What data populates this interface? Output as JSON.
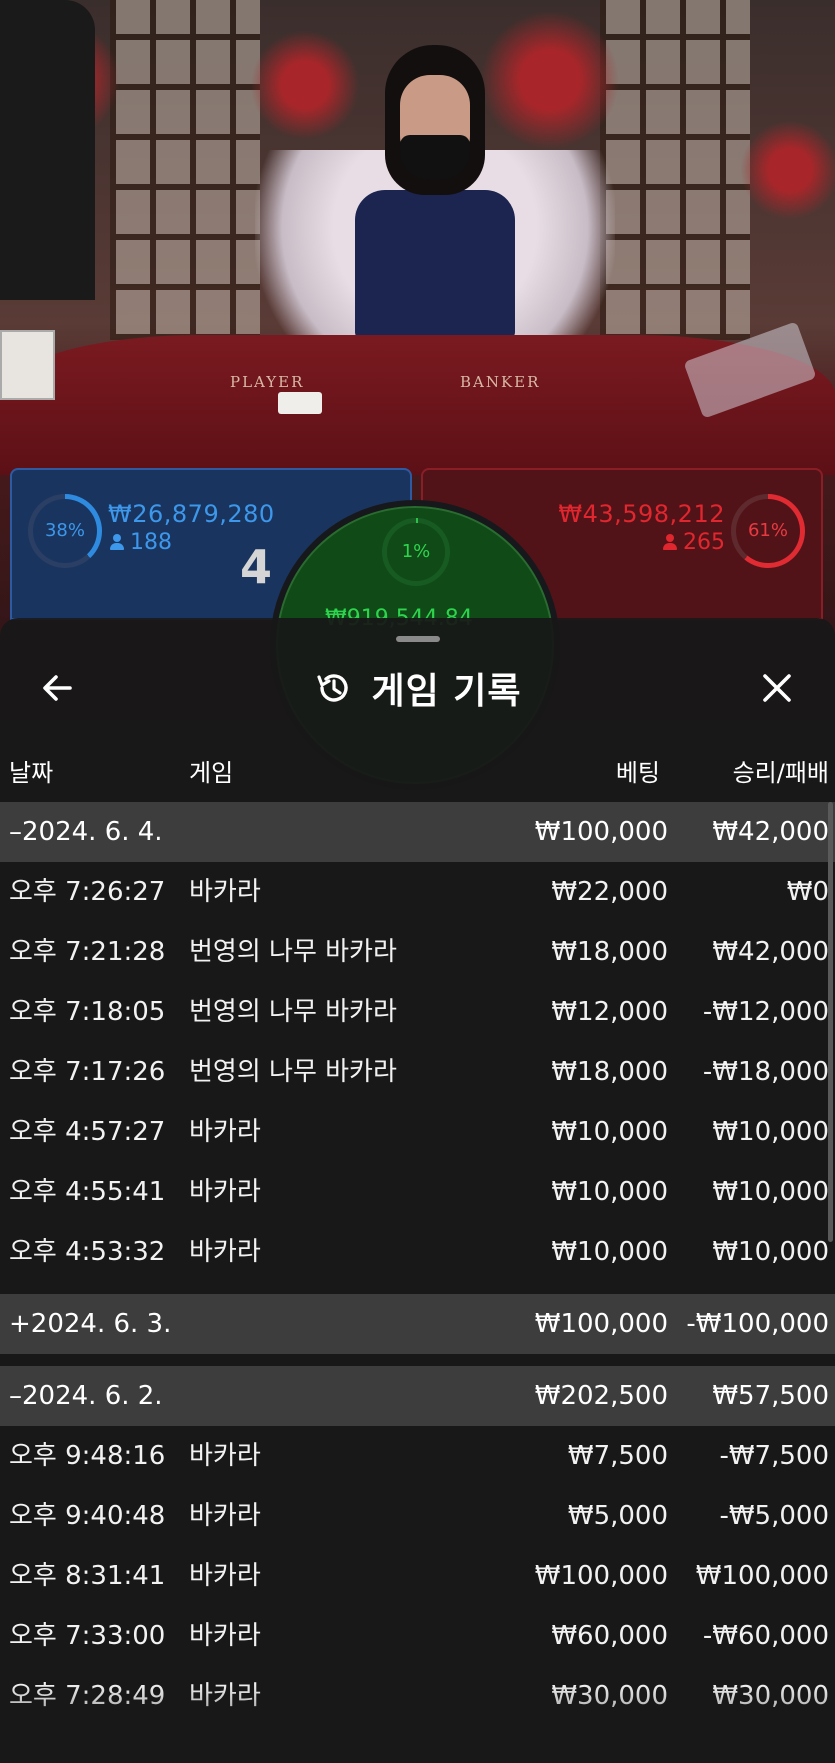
{
  "stream": {
    "table_labels": [
      "PLAYER",
      "BANKER"
    ]
  },
  "bets": {
    "player": {
      "percent": "38%",
      "amount": "₩26,879,280",
      "players": "188",
      "score": "4"
    },
    "banker": {
      "percent": "61%",
      "amount": "₩43,598,212",
      "players": "265"
    },
    "tie": {
      "percent": "1%",
      "amount": "₩919,544.84"
    }
  },
  "sheet": {
    "title": "게임 기록",
    "icons": {
      "back": "arrow-left-icon",
      "history": "history-icon",
      "close": "close-icon"
    },
    "columns": {
      "date": "날짜",
      "game": "게임",
      "bet": "베팅",
      "result": "승리/패배"
    },
    "groups": [
      {
        "label": "–2024. 6. 4.",
        "bet": "₩100,000",
        "result": "₩42,000",
        "expanded": true,
        "rows": [
          {
            "time": "오후 7:26:27",
            "game": "바카라",
            "bet": "₩22,000",
            "result": "₩0"
          },
          {
            "time": "오후 7:21:28",
            "game": "번영의 나무 바카라",
            "bet": "₩18,000",
            "result": "₩42,000"
          },
          {
            "time": "오후 7:18:05",
            "game": "번영의 나무 바카라",
            "bet": "₩12,000",
            "result": "-₩12,000"
          },
          {
            "time": "오후 7:17:26",
            "game": "번영의 나무 바카라",
            "bet": "₩18,000",
            "result": "-₩18,000"
          },
          {
            "time": "오후 4:57:27",
            "game": "바카라",
            "bet": "₩10,000",
            "result": "₩10,000"
          },
          {
            "time": "오후 4:55:41",
            "game": "바카라",
            "bet": "₩10,000",
            "result": "₩10,000"
          },
          {
            "time": "오후 4:53:32",
            "game": "바카라",
            "bet": "₩10,000",
            "result": "₩10,000"
          }
        ]
      },
      {
        "label": "+2024. 6. 3.",
        "bet": "₩100,000",
        "result": "-₩100,000",
        "expanded": false,
        "rows": []
      },
      {
        "label": "–2024. 6. 2.",
        "bet": "₩202,500",
        "result": "₩57,500",
        "expanded": true,
        "rows": [
          {
            "time": "오후 9:48:16",
            "game": "바카라",
            "bet": "₩7,500",
            "result": "-₩7,500"
          },
          {
            "time": "오후 9:40:48",
            "game": "바카라",
            "bet": "₩5,000",
            "result": "-₩5,000"
          },
          {
            "time": "오후 8:31:41",
            "game": "바카라",
            "bet": "₩100,000",
            "result": "₩100,000"
          },
          {
            "time": "오후 7:33:00",
            "game": "바카라",
            "bet": "₩60,000",
            "result": "-₩60,000"
          },
          {
            "time": "오후 7:28:49",
            "game": "바카라",
            "bet": "₩30,000",
            "result": "₩30,000"
          }
        ]
      }
    ]
  }
}
